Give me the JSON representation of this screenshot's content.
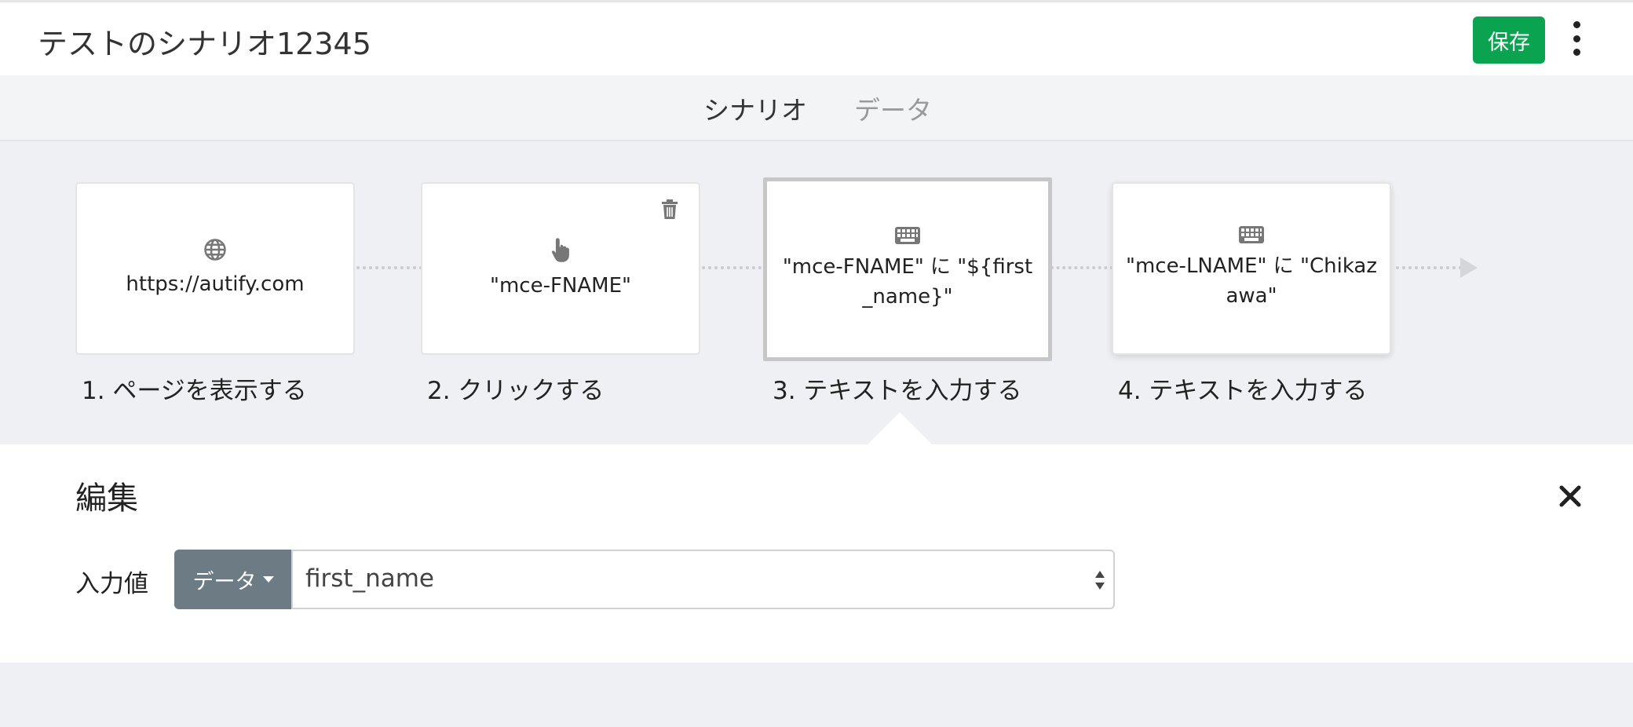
{
  "header": {
    "title": "テストのシナリオ12345",
    "save_label": "保存"
  },
  "tabs": [
    {
      "label": "シナリオ",
      "active": true
    },
    {
      "label": "データ",
      "active": false
    }
  ],
  "steps": [
    {
      "text": "https://autify.com",
      "label": "1. ページを表示する",
      "icon": "globe-icon"
    },
    {
      "text": "\"mce-FNAME\"",
      "label": "2. クリックする",
      "icon": "pointer-hand-icon"
    },
    {
      "text": "\"mce-FNAME\" に \"${first_name}\"",
      "label": "3. テキストを入力する",
      "icon": "keyboard-icon",
      "selected": true
    },
    {
      "text": "\"mce-LNAME\" に \"Chikazawa\"",
      "label": "4. テキストを入力する",
      "icon": "keyboard-icon"
    }
  ],
  "edit": {
    "title": "編集",
    "field_label": "入力値",
    "source_button": "データ",
    "selected_value": "first_name"
  },
  "colors": {
    "save": "#0aa34f",
    "data_button": "#6c7b84"
  }
}
